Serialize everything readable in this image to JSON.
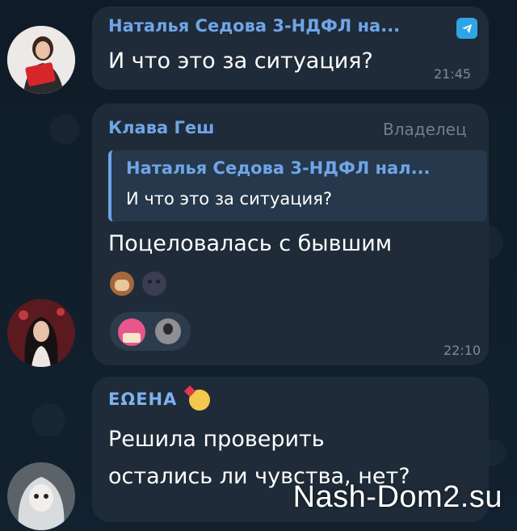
{
  "messages": [
    {
      "sender": "Наталья Седова 3-НДФЛ на...",
      "text": "И что это за ситуация?",
      "time": "21:45",
      "avatar_icon": "avatar-woman-red-folder"
    },
    {
      "sender": "Клава Геш",
      "badge": "Владелец",
      "reply": {
        "name": "Наталья Седова 3-НДФЛ нал...",
        "text": "И что это за ситуация?"
      },
      "text": "Поцеловалась с бывшим",
      "emojis": [
        "see-no-evil-monkey",
        "new-moon-face"
      ],
      "reactions": [
        "mushroom-cake-sticker",
        "avatar-thumb"
      ],
      "time": "22:10",
      "avatar_icon": "avatar-woman-dark-hair"
    },
    {
      "sender": "ΕΩΕΗΑ",
      "sender_emoji": "face-with-hearts",
      "text_line1": "Решила проверить",
      "text_line2": "остались ли чувства, нет?",
      "avatar_icon": "avatar-doll-girl"
    }
  ],
  "watermark": "Nash-Dom2.su",
  "colors": {
    "background": "#101d2a",
    "bubble": "#1f2b38",
    "accent": "#6fa5e8",
    "telegram": "#2ea6e6"
  }
}
